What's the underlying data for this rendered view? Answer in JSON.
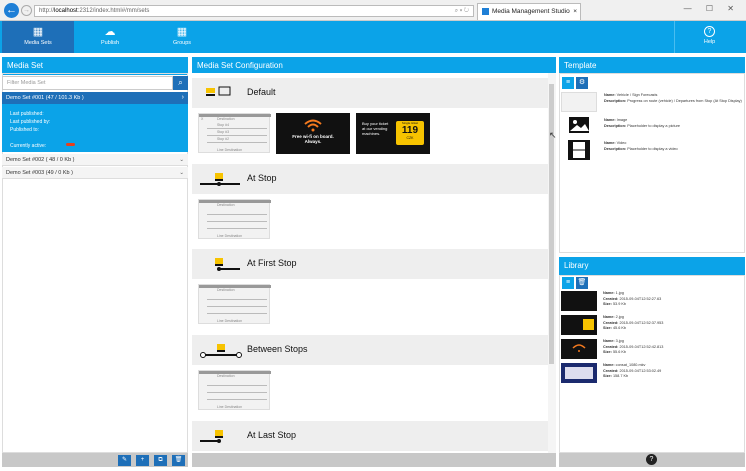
{
  "browser": {
    "back": "←",
    "forward": "→",
    "url_prefix": "http://",
    "url_host": "localhost",
    "url_rest": ":2312/index.html#/mm/sets",
    "url_controls": "⌕ ▾ ↻",
    "tab_title": "Media Management Studio",
    "tab_close": "×",
    "window_controls": "— ☐ ✕"
  },
  "nav": {
    "items": [
      {
        "label": "Media Sets",
        "icon": "▦"
      },
      {
        "label": "Publish",
        "icon": "☁"
      },
      {
        "label": "Groups",
        "icon": "▦"
      }
    ],
    "help": {
      "label": "Help",
      "icon": "?"
    }
  },
  "left": {
    "title": "Media Set",
    "filter_placeholder": "Filter Media Set",
    "search_icon": "⌕",
    "selected": {
      "label": "Demo Set #001 (47 / 101.3 Kb )",
      "chevron": "›"
    },
    "details": [
      "Last published:",
      "Last published by:",
      "Published to:",
      "",
      "Currently active:"
    ],
    "others": [
      {
        "label": "Demo Set #002 ( 48 / 0 Kb )",
        "chevron": "⌄"
      },
      {
        "label": "Demo Set #003 (49 / 0 Kb )",
        "chevron": "⌄"
      }
    ],
    "footer_icons": [
      "✎",
      "+",
      "⧉",
      "🗑"
    ]
  },
  "center": {
    "title": "Media Set Configuration",
    "states": [
      {
        "label": "Default"
      },
      {
        "label": "At Stop"
      },
      {
        "label": "At First Stop"
      },
      {
        "label": "Between Stops"
      },
      {
        "label": "At Last Stop"
      }
    ],
    "template_text": {
      "col": "X",
      "destination": "Destination",
      "stop4": "Stop #4",
      "stop3": "Stop #3",
      "stop2": "Stop #2",
      "stop1": "Stop #1",
      "line": "Line Destination",
      "time": "8 min"
    },
    "ad1": {
      "line1": "Free wi-fi on board.",
      "line2": "Always."
    },
    "ad2": {
      "line1": "Buy your ticket",
      "line2": "at our vending",
      "line3": "machines.",
      "badge_top": "Single ticket",
      "price": "119",
      ".sub": "",
      "currency": "CZK"
    }
  },
  "template": {
    "title": "Template",
    "toggle_icons": [
      "≡",
      "⚙"
    ],
    "items": [
      {
        "name_label": "Name:",
        "name": "Vehicle / Sign Forecasts",
        "desc_label": "Description:",
        "desc": "Progress on route (vehicle) / Departures from Stop (At Stop Display)"
      },
      {
        "name_label": "Name:",
        "name": "Image",
        "desc_label": "Description:",
        "desc": "Placeholder to display a picture"
      },
      {
        "name_label": "Name:",
        "name": "Video",
        "desc_label": "Description:",
        "desc": "Placeholder to display a video"
      }
    ]
  },
  "library": {
    "title": "Library",
    "toggle_icons": [
      "≡",
      "🗑"
    ],
    "items": [
      {
        "name": "1.jpg",
        "created": "2015-09-04T12:52:27.63",
        "size": "53.9 Kb"
      },
      {
        "name": "2.jpg",
        "created": "2015-09-04T12:52:37.953",
        "size": "45.6 Kb"
      },
      {
        "name": "3.jpg",
        "created": "2015-09-04T12:52:42.813",
        "size": "55.6 Kb"
      },
      {
        "name": "consat_1080.mkv",
        "created": "2015-09-04T12:53:02.49",
        "size": "158.7 Kb"
      }
    ],
    "labels": {
      "name": "Name:",
      "created": "Created:",
      "size": "Size:"
    }
  },
  "colors": {
    "accent": "#0ba3e8",
    "accent_dark": "#1e6fb8",
    "yellow": "#f7c300"
  }
}
